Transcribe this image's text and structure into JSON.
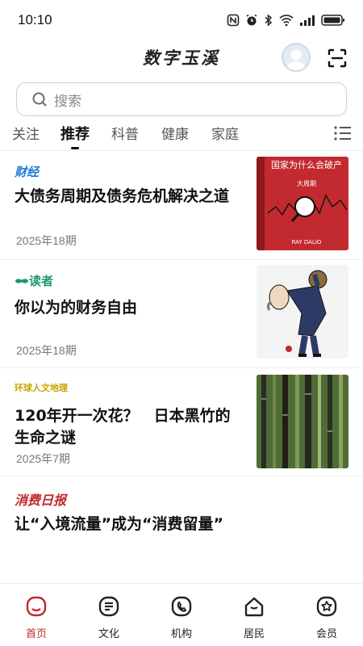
{
  "status_bar": {
    "time": "10:10"
  },
  "header": {
    "title": "数字玉溪"
  },
  "search": {
    "placeholder": "搜索"
  },
  "tabs": [
    {
      "label": "关注"
    },
    {
      "label": "推荐",
      "active": true
    },
    {
      "label": "科普"
    },
    {
      "label": "健康"
    },
    {
      "label": "家庭"
    }
  ],
  "articles": [
    {
      "source": "财经",
      "title": "大债务周期及债务危机解决之道",
      "date": "2025年18期",
      "thumb": {
        "title": "国家为什么会破产",
        "subtitle": "大周期",
        "author": "RAY DALIO"
      }
    },
    {
      "source": "读者",
      "title": "你以为的财务自由",
      "date": "2025年18期"
    },
    {
      "source": "环球人文地理",
      "title": "120年开一次花？　日本黑竹的生命之谜",
      "date": "2025年7期"
    },
    {
      "source": "消费日报",
      "title": "让“入境流量”成为“消费留量”"
    }
  ],
  "bottom_nav": [
    {
      "label": "首页",
      "icon": "home-icon",
      "active": true
    },
    {
      "label": "文化",
      "icon": "culture-icon"
    },
    {
      "label": "机构",
      "icon": "institution-icon"
    },
    {
      "label": "居民",
      "icon": "resident-icon"
    },
    {
      "label": "会员",
      "icon": "member-icon"
    }
  ],
  "colors": {
    "accent": "#c0282d",
    "source_caijing": "#1f7ad1",
    "source_duzhe": "#1a9a6c",
    "source_consumer": "#c0282d"
  }
}
